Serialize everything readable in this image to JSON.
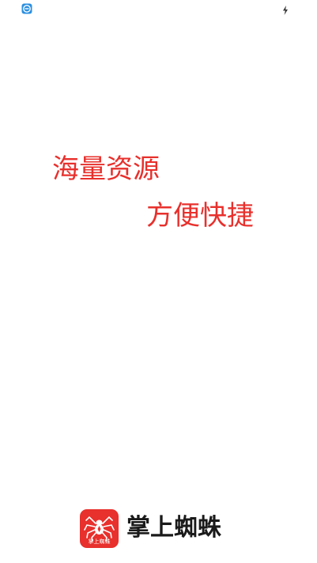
{
  "status_bar": {
    "left_icon": "app-notification-icon",
    "right_icon": "charging-bolt-icon"
  },
  "slogans": {
    "line1": "海量资源",
    "line2": "方便快捷"
  },
  "brand": {
    "logo_icon": "spider-icon",
    "logo_caption": "掌上蜘蛛",
    "name": "掌上蜘蛛"
  },
  "colors": {
    "accent": "#e8302c",
    "background": "#ffffff",
    "brand_text": "#1a1a1a"
  }
}
